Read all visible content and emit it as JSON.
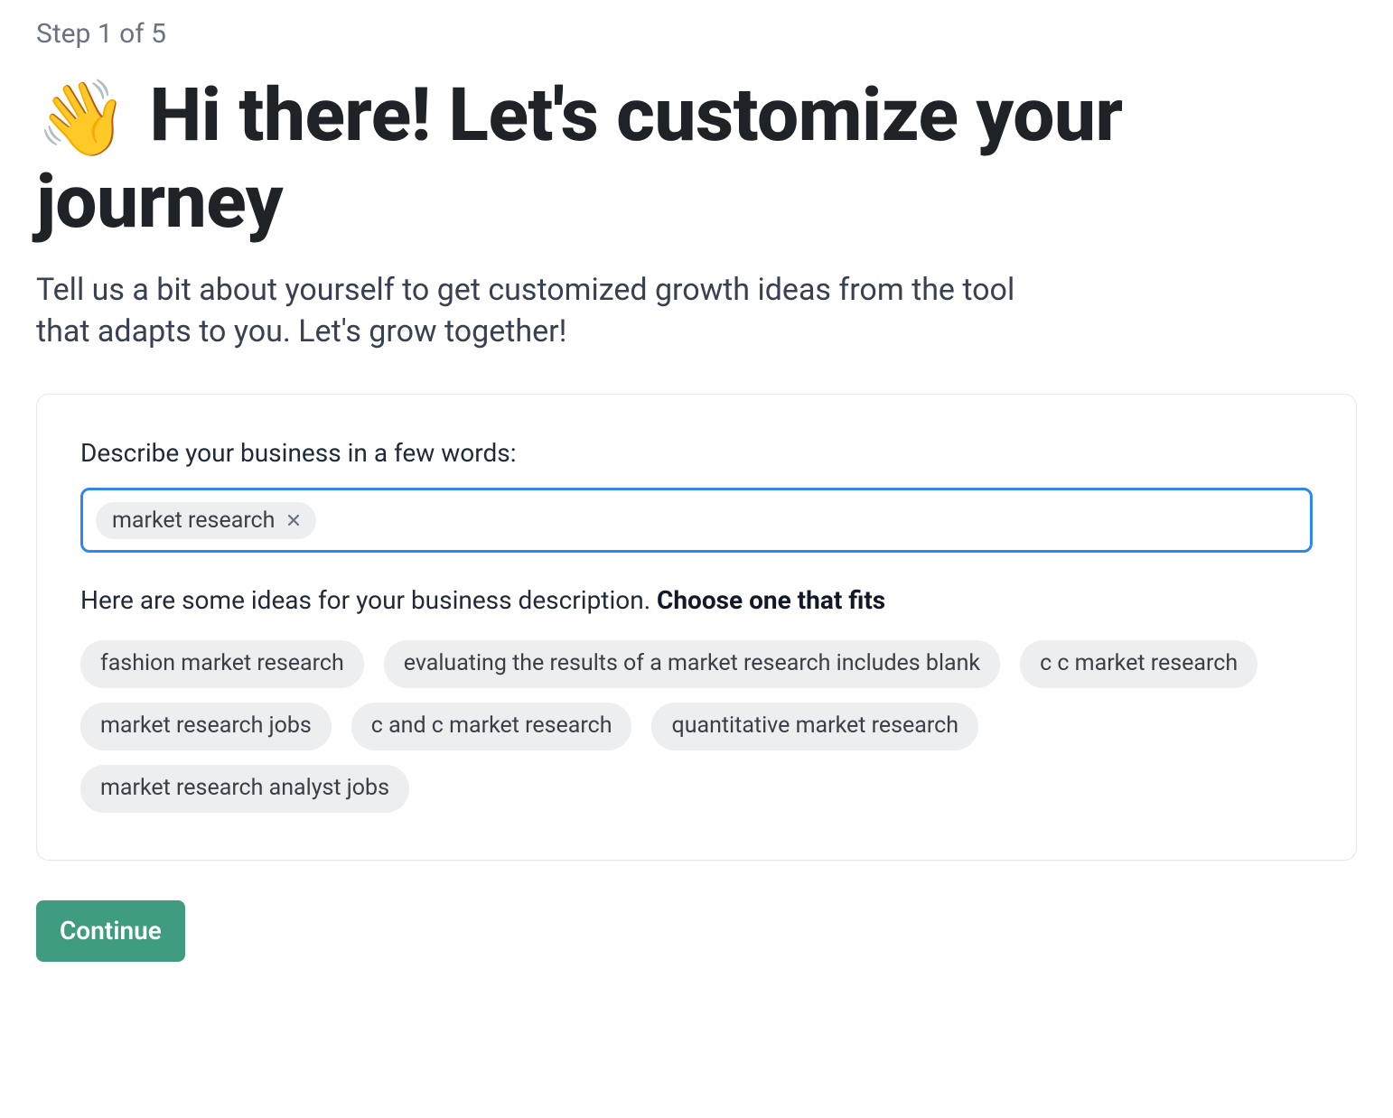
{
  "step_label": "Step 1 of 5",
  "heading_emoji": "👋",
  "heading_text": "Hi there! Let's customize your journey",
  "subheading": "Tell us a bit about yourself to get customized growth ideas from the tool that adapts to you. Let's grow together!",
  "card": {
    "field_label": "Describe your business in a few words:",
    "tags": [
      {
        "label": "market research"
      }
    ],
    "ideas_prefix": "Here are some ideas for your business description. ",
    "ideas_strong": "Choose one that fits",
    "suggestions": [
      "fashion market research",
      "evaluating the results of a market research includes blank",
      "c c market research",
      "market research jobs",
      "c and c market research",
      "quantitative market research",
      "market research analyst jobs"
    ]
  },
  "continue_label": "Continue"
}
